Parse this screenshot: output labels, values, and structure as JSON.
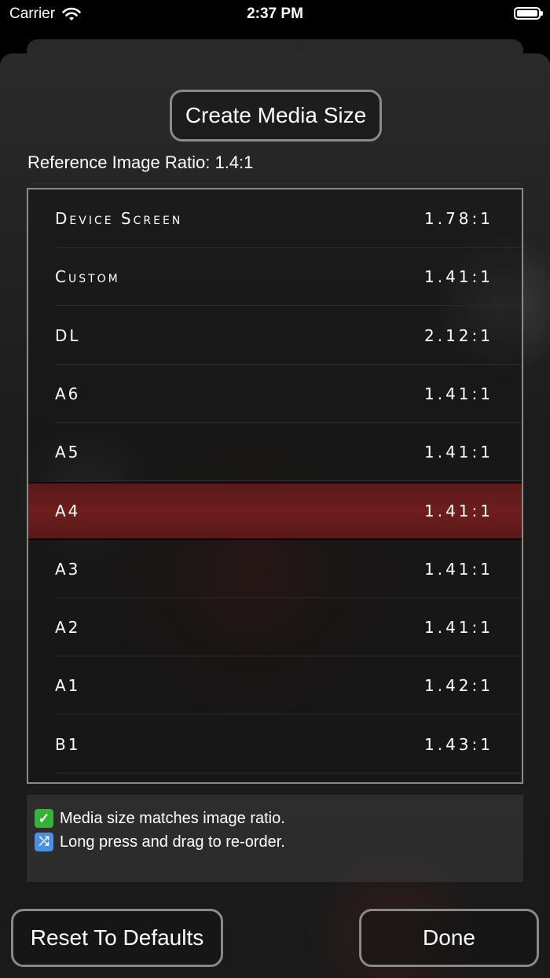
{
  "status": {
    "carrier": "Carrier",
    "time": "2:37 PM"
  },
  "header": {
    "create_button": "Create Media Size",
    "reference_ratio": "Reference Image Ratio: 1.4:1"
  },
  "media_sizes": [
    {
      "name": "Device Screen",
      "ratio": "1.78:1",
      "selected": false
    },
    {
      "name": "Custom",
      "ratio": "1.41:1",
      "selected": false
    },
    {
      "name": "DL",
      "ratio": "2.12:1",
      "selected": false
    },
    {
      "name": "A6",
      "ratio": "1.41:1",
      "selected": false
    },
    {
      "name": "A5",
      "ratio": "1.41:1",
      "selected": false
    },
    {
      "name": "A4",
      "ratio": "1.41:1",
      "selected": true
    },
    {
      "name": "A3",
      "ratio": "1.41:1",
      "selected": false
    },
    {
      "name": "A2",
      "ratio": "1.41:1",
      "selected": false
    },
    {
      "name": "A1",
      "ratio": "1.42:1",
      "selected": false
    },
    {
      "name": "B1",
      "ratio": "1.43:1",
      "selected": false
    }
  ],
  "info": {
    "line1_icon": "check-icon",
    "line1": "Media size matches image ratio.",
    "line2_icon": "shuffle-icon",
    "line2": "Long press and drag to re-order."
  },
  "footer": {
    "reset_button": "Reset To Defaults",
    "done_button": "Done"
  },
  "colors": {
    "selected_row": "#6e1d1d",
    "border": "#8a8a8a"
  }
}
